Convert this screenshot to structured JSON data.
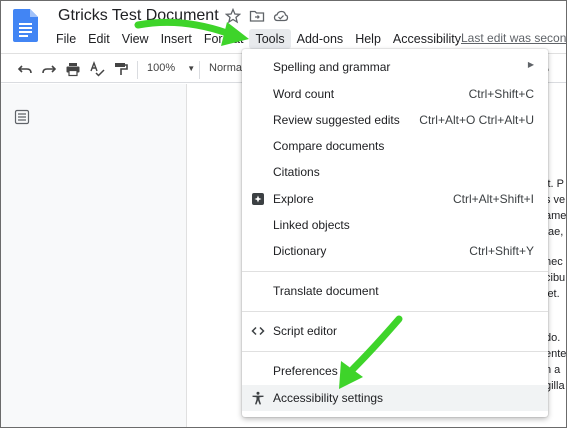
{
  "header": {
    "doc_title": "Gtricks Test Document",
    "last_edit": "Last edit was second"
  },
  "menubar": {
    "items": [
      {
        "label": "File"
      },
      {
        "label": "Edit"
      },
      {
        "label": "View"
      },
      {
        "label": "Insert"
      },
      {
        "label": "Format"
      },
      {
        "label": "Tools"
      },
      {
        "label": "Add-ons"
      },
      {
        "label": "Help"
      },
      {
        "label": "Accessibility"
      }
    ],
    "active": "Tools"
  },
  "toolbar": {
    "zoom": "100%",
    "style": "Normal"
  },
  "tools_menu": {
    "items": [
      {
        "label": "Spelling and grammar",
        "submenu": true
      },
      {
        "label": "Word count",
        "shortcut": "Ctrl+Shift+C"
      },
      {
        "label": "Review suggested edits",
        "shortcut": "Ctrl+Alt+O Ctrl+Alt+U"
      },
      {
        "label": "Compare documents"
      },
      {
        "label": "Citations"
      },
      {
        "label": "Explore",
        "shortcut": "Ctrl+Alt+Shift+I",
        "icon": "explore-icon"
      },
      {
        "label": "Linked objects"
      },
      {
        "label": "Dictionary",
        "shortcut": "Ctrl+Shift+Y"
      },
      {
        "label": "Translate document"
      },
      {
        "label": "Script editor",
        "icon": "code-icon"
      },
      {
        "label": "Preferences"
      },
      {
        "label": "Accessibility settings",
        "icon": "accessibility-icon",
        "highlighted": true
      }
    ]
  },
  "document": {
    "fragments": [
      "it. P",
      "s ve",
      "ame",
      "tae,",
      "nec",
      "cibu",
      "iet.",
      "do.",
      "ente",
      "n a",
      "gilla"
    ]
  },
  "colors": {
    "accent_blue": "#4285f4",
    "annotation_green": "#3ed42a",
    "menu_highlight": "#f1f3f4"
  }
}
